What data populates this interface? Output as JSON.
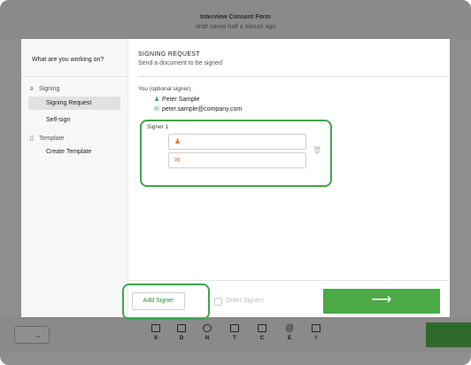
{
  "header": {
    "document_title": "Interview Consent Form",
    "save_status": "draft saved half a minute ago"
  },
  "sidebar": {
    "heading": "What are you working on?",
    "sections": [
      {
        "label": "Signing",
        "icon": "pen-icon",
        "items": [
          {
            "label": "Signing Request",
            "active": true
          },
          {
            "label": "Self-sign",
            "active": false
          }
        ]
      },
      {
        "label": "Template",
        "icon": "document-icon",
        "items": [
          {
            "label": "Create Template",
            "active": false
          }
        ]
      }
    ]
  },
  "main": {
    "title": "SIGNING REQUEST",
    "subtitle": "Send a document to be signed",
    "you": {
      "label": "You (optional signer)",
      "name": "Peter Sample",
      "email": "peter.sample@company.com"
    },
    "signer": {
      "label": "Signer 1",
      "name_value": "",
      "email_value": ""
    }
  },
  "footer": {
    "add_signer_label": "Add Signer",
    "order_signers_label": "Order Signers",
    "next_glyph": "⟶"
  },
  "toolbar": {
    "tools": [
      {
        "key": "S",
        "icon": "signature-icon"
      },
      {
        "key": "D",
        "icon": "calendar-icon"
      },
      {
        "key": "N",
        "icon": "person-icon"
      },
      {
        "key": "T",
        "icon": "text-field-icon"
      },
      {
        "key": "C",
        "icon": "checkbox-icon"
      },
      {
        "key": "E",
        "icon": "at-email-icon"
      },
      {
        "key": "I",
        "icon": "initials-icon"
      }
    ]
  },
  "colors": {
    "accent_green": "#4caa47",
    "highlight_green": "#3fa64a",
    "field_icon_orange": "#e07a2e",
    "dim_overlay": "#8e8e8e"
  }
}
